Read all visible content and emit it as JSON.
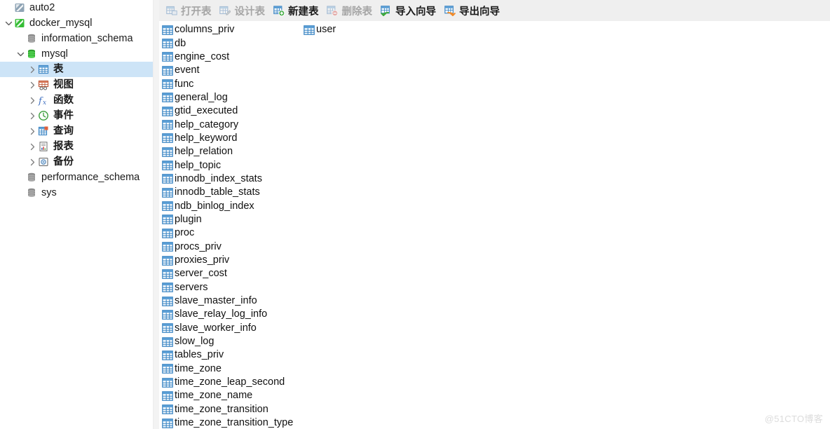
{
  "colors": {
    "selection": "#cde4f7",
    "toolbar_bg": "#efefef",
    "splitter": "#f3f3f3",
    "connected_green": "#35bd35",
    "disconnected_gray": "#8fa4b5",
    "table_icon_blue": "#3f88c5",
    "watermark": "#dcdcdc"
  },
  "sidebar": {
    "items": [
      {
        "label": "auto2",
        "icon": "connection-offline-icon",
        "indent": 0,
        "twisty": "none",
        "selected": false
      },
      {
        "label": "docker_mysql",
        "icon": "connection-online-icon",
        "indent": 0,
        "twisty": "expanded",
        "selected": false
      },
      {
        "label": "information_schema",
        "icon": "database-closed-icon",
        "indent": 1,
        "twisty": "none",
        "selected": false
      },
      {
        "label": "mysql",
        "icon": "database-open-icon",
        "indent": 1,
        "twisty": "expanded",
        "selected": false
      },
      {
        "label": "表",
        "icon": "tables-folder-icon",
        "indent": 2,
        "twisty": "collapsed",
        "selected": true,
        "cjk": true
      },
      {
        "label": "视图",
        "icon": "views-folder-icon",
        "indent": 2,
        "twisty": "collapsed",
        "selected": false,
        "cjk": true
      },
      {
        "label": "函数",
        "icon": "functions-folder-icon",
        "indent": 2,
        "twisty": "collapsed",
        "selected": false,
        "cjk": true
      },
      {
        "label": "事件",
        "icon": "events-folder-icon",
        "indent": 2,
        "twisty": "collapsed",
        "selected": false,
        "cjk": true
      },
      {
        "label": "查询",
        "icon": "queries-folder-icon",
        "indent": 2,
        "twisty": "collapsed",
        "selected": false,
        "cjk": true
      },
      {
        "label": "报表",
        "icon": "reports-folder-icon",
        "indent": 2,
        "twisty": "collapsed",
        "selected": false,
        "cjk": true
      },
      {
        "label": "备份",
        "icon": "backups-folder-icon",
        "indent": 2,
        "twisty": "collapsed",
        "selected": false,
        "cjk": true
      },
      {
        "label": "performance_schema",
        "icon": "database-closed-icon",
        "indent": 1,
        "twisty": "none",
        "selected": false
      },
      {
        "label": "sys",
        "icon": "database-closed-icon",
        "indent": 1,
        "twisty": "none",
        "selected": false
      }
    ]
  },
  "toolbar": {
    "items": [
      {
        "label": "打开表",
        "icon": "open-table-icon",
        "enabled": false
      },
      {
        "label": "设计表",
        "icon": "design-table-icon",
        "enabled": false
      },
      {
        "label": "新建表",
        "icon": "new-table-icon",
        "enabled": true
      },
      {
        "label": "删除表",
        "icon": "delete-table-icon",
        "enabled": false
      },
      {
        "label": "导入向导",
        "icon": "import-wizard-icon",
        "enabled": true
      },
      {
        "label": "导出向导",
        "icon": "export-wizard-icon",
        "enabled": true
      }
    ]
  },
  "table_list": {
    "icon": "table-icon",
    "column1": [
      "columns_priv",
      "db",
      "engine_cost",
      "event",
      "func",
      "general_log",
      "gtid_executed",
      "help_category",
      "help_keyword",
      "help_relation",
      "help_topic",
      "innodb_index_stats",
      "innodb_table_stats",
      "ndb_binlog_index",
      "plugin",
      "proc",
      "procs_priv",
      "proxies_priv",
      "server_cost",
      "servers",
      "slave_master_info",
      "slave_relay_log_info",
      "slave_worker_info",
      "slow_log",
      "tables_priv",
      "time_zone",
      "time_zone_leap_second",
      "time_zone_name",
      "time_zone_transition",
      "time_zone_transition_type"
    ],
    "column2": [
      "user"
    ]
  },
  "watermark": {
    "text": "@51CTO博客"
  }
}
